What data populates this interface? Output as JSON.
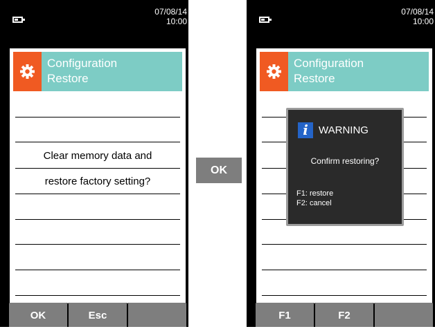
{
  "left_screen": {
    "date": "07/08/14",
    "time": "10:00",
    "title_line1": "Configuration",
    "title_line2": "Restore",
    "message_line1": "Clear memory data and",
    "message_line2": "restore factory setting?",
    "fkeys": [
      "OK",
      "Esc",
      ""
    ]
  },
  "transition_key": "OK",
  "right_screen": {
    "date": "07/08/14",
    "time": "10:00",
    "title_line1": "Configuration",
    "title_line2": "Restore",
    "fkeys": [
      "F1",
      "F2",
      ""
    ],
    "dialog": {
      "icon": "info-icon",
      "title": "WARNING",
      "message": "Confirm restoring?",
      "option1": "F1: restore",
      "option2": "F2: cancel"
    }
  },
  "colors": {
    "title_icon_bg": "#f05a22",
    "title_bg": "#7dccc5",
    "fkey_bg": "#7e7e7e",
    "dialog_bg": "#2a2a2a",
    "info_icon_bg": "#2464c8"
  }
}
